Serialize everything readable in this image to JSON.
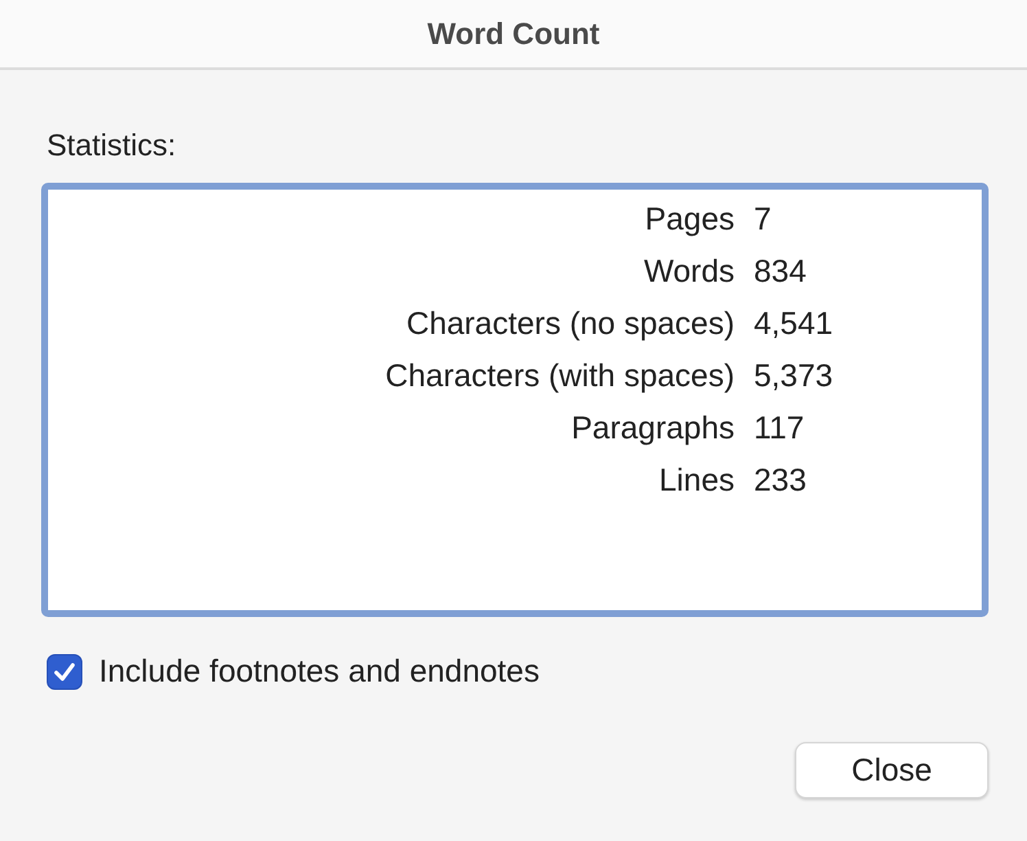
{
  "window": {
    "title": "Word Count"
  },
  "statistics": {
    "label": "Statistics:",
    "rows": [
      {
        "name": "Pages",
        "value": "7"
      },
      {
        "name": "Words",
        "value": "834"
      },
      {
        "name": "Characters (no spaces)",
        "value": "4,541"
      },
      {
        "name": "Characters (with spaces)",
        "value": "5,373"
      },
      {
        "name": "Paragraphs",
        "value": "117"
      },
      {
        "name": "Lines",
        "value": "233"
      }
    ]
  },
  "include_notes": {
    "label": "Include footnotes and endnotes",
    "checked": true
  },
  "buttons": [
    "Close"
  ]
}
